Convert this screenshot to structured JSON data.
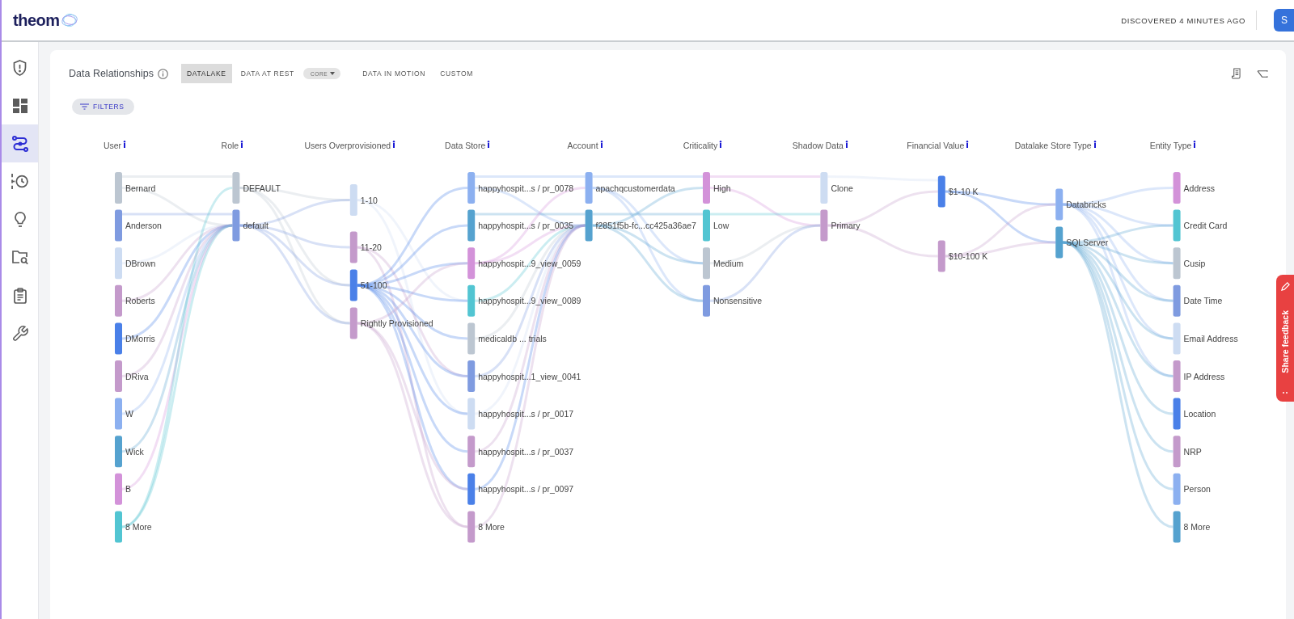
{
  "topbar": {
    "logo": "theom",
    "status": "DISCOVERED 4 MINUTES AGO",
    "avatar": "S"
  },
  "sidebar": {
    "items": [
      {
        "kind": "shield",
        "selected": false
      },
      {
        "kind": "dashboard",
        "selected": false
      },
      {
        "kind": "flow",
        "selected": true
      },
      {
        "kind": "timeline",
        "selected": false
      },
      {
        "kind": "bulb",
        "selected": false
      },
      {
        "kind": "folder-search",
        "selected": false
      },
      {
        "kind": "clipboard",
        "selected": false
      },
      {
        "kind": "wrench",
        "selected": false
      }
    ]
  },
  "panel": {
    "title": "Data Relationships",
    "tabs": [
      {
        "label": "DATALAKE",
        "selected": true
      },
      {
        "label": "DATA AT REST",
        "selected": false,
        "dropdown": "CORE"
      },
      {
        "label": "DATA IN MOTION",
        "selected": false
      },
      {
        "label": "CUSTOM",
        "selected": false
      }
    ],
    "filters": "FILTERS"
  },
  "sankey": {
    "columns": [
      {
        "title": "User",
        "nodes": [
          {
            "label": "Bernard",
            "color": "#bcc6d1"
          },
          {
            "label": "Anderson",
            "color": "#7f9be0"
          },
          {
            "label": "DBrown",
            "color": "#cddcf2"
          },
          {
            "label": "Roberts",
            "color": "#c49acb"
          },
          {
            "label": "DMorris",
            "color": "#4a80e8"
          },
          {
            "label": "DRiva",
            "color": "#c49acb"
          },
          {
            "label": "W",
            "color": "#8cb0f0"
          },
          {
            "label": "Wick",
            "color": "#55a2cf"
          },
          {
            "label": "B",
            "color": "#d392d9"
          },
          {
            "label": "8 More",
            "color": "#52c5d2"
          }
        ]
      },
      {
        "title": "Role",
        "nodes": [
          {
            "label": "DEFAULT",
            "color": "#bcc6d1"
          },
          {
            "label": "default",
            "color": "#7f9be0"
          }
        ]
      },
      {
        "title": "Users Overprovisioned",
        "nodes": [
          {
            "label": "1-10",
            "color": "#cddcf2"
          },
          {
            "label": "11-20",
            "color": "#c49acb"
          },
          {
            "label": "51-100",
            "color": "#4a80e8"
          },
          {
            "label": "Rightly Provisioned",
            "color": "#c49acb"
          }
        ]
      },
      {
        "title": "Data Store",
        "nodes": [
          {
            "label": "happyhospit...s / pr_0078",
            "color": "#8cb0f0"
          },
          {
            "label": "happyhospit...s / pr_0035",
            "color": "#55a2cf"
          },
          {
            "label": "happyhospit...9_view_0059",
            "color": "#d392d9"
          },
          {
            "label": "happyhospit...9_view_0089",
            "color": "#52c5d2"
          },
          {
            "label": "medicaldb ... trials",
            "color": "#bcc6d1"
          },
          {
            "label": "happyhospit...1_view_0041",
            "color": "#7f9be0"
          },
          {
            "label": "happyhospit...s / pr_0017",
            "color": "#cddcf2"
          },
          {
            "label": "happyhospit...s / pr_0037",
            "color": "#c49acb"
          },
          {
            "label": "happyhospit...s / pr_0097",
            "color": "#4a80e8"
          },
          {
            "label": "8 More",
            "color": "#c49acb"
          }
        ]
      },
      {
        "title": "Account",
        "nodes": [
          {
            "label": "apachqcustomerdata",
            "color": "#8cb0f0"
          },
          {
            "label": "f2851f5b-fc...cc425a36ae7",
            "color": "#55a2cf"
          }
        ]
      },
      {
        "title": "Criticality",
        "nodes": [
          {
            "label": "High",
            "color": "#d392d9"
          },
          {
            "label": "Low",
            "color": "#52c5d2"
          },
          {
            "label": "Medium",
            "color": "#bcc6d1"
          },
          {
            "label": "Nonsensitive",
            "color": "#7f9be0"
          }
        ]
      },
      {
        "title": "Shadow Data",
        "nodes": [
          {
            "label": "Clone",
            "color": "#cddcf2"
          },
          {
            "label": "Primary",
            "color": "#c49acb"
          }
        ]
      },
      {
        "title": "Financial Value",
        "nodes": [
          {
            "label": "$1-10 K",
            "color": "#4a80e8"
          },
          {
            "label": "$10-100 K",
            "color": "#c49acb"
          }
        ]
      },
      {
        "title": "Datalake Store Type",
        "nodes": [
          {
            "label": "Databricks",
            "color": "#8cb0f0"
          },
          {
            "label": "SQLServer",
            "color": "#55a2cf"
          }
        ]
      },
      {
        "title": "Entity Type",
        "nodes": [
          {
            "label": "Address",
            "color": "#d392d9"
          },
          {
            "label": "Credit Card",
            "color": "#52c5d2"
          },
          {
            "label": "Cusip",
            "color": "#bcc6d1"
          },
          {
            "label": "Date Time",
            "color": "#7f9be0"
          },
          {
            "label": "Email Address",
            "color": "#cddcf2"
          },
          {
            "label": "IP Address",
            "color": "#c49acb"
          },
          {
            "label": "Location",
            "color": "#4a80e8"
          },
          {
            "label": "NRP",
            "color": "#c49acb"
          },
          {
            "label": "Person",
            "color": "#8cb0f0"
          },
          {
            "label": "8 More",
            "color": "#55a2cf"
          }
        ]
      }
    ]
  },
  "feedback": {
    "label": "Share feedback"
  }
}
